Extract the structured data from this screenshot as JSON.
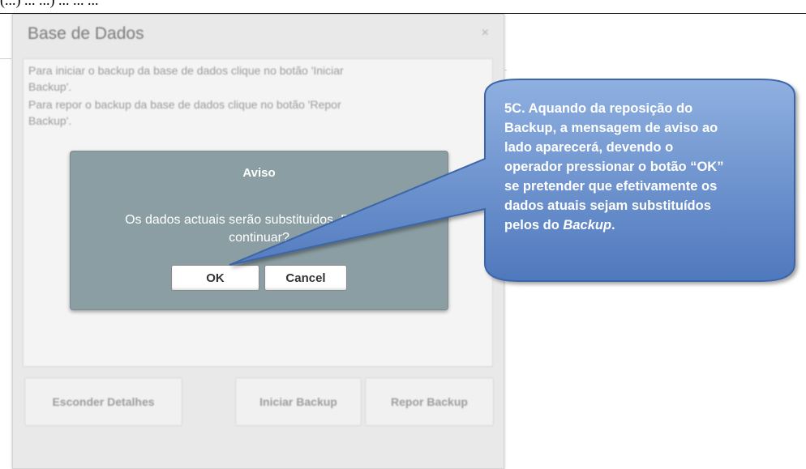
{
  "document": {
    "top_line": "(...) ... ...) ... ... ..."
  },
  "dialog": {
    "title": "Base de Dados",
    "close_glyph": "×",
    "details": [
      "Para iniciar o backup da base de dados clique no botão 'Iniciar",
      "Backup'.",
      "Para repor o backup da base de dados clique no botão 'Repor",
      "Backup'."
    ],
    "buttons": {
      "hide_details": "Esconder Detalhes",
      "start_backup": "Iniciar Backup",
      "restore_backup": "Repor Backup"
    }
  },
  "alert": {
    "title": "Aviso",
    "message_line1": "Os dados actuais serão substituidos. Pretende",
    "message_line2": "continuar?",
    "ok_label": "OK",
    "cancel_label": "Cancel"
  },
  "callout": {
    "line1": "5C. Aquando da reposição do",
    "line2": "Backup, a mensagem de aviso ao",
    "line3": "lado aparecerá, devendo o",
    "line4": "operador pressionar o botão “OK”",
    "line5": "se pretender que efetivamente os",
    "line6": "dados atuais sejam substituídos",
    "line7_prefix": "pelos do ",
    "line7_italic": "Backup",
    "line7_suffix": ".",
    "fill_color": "#6f93cf",
    "border_color": "#3c66a8"
  }
}
